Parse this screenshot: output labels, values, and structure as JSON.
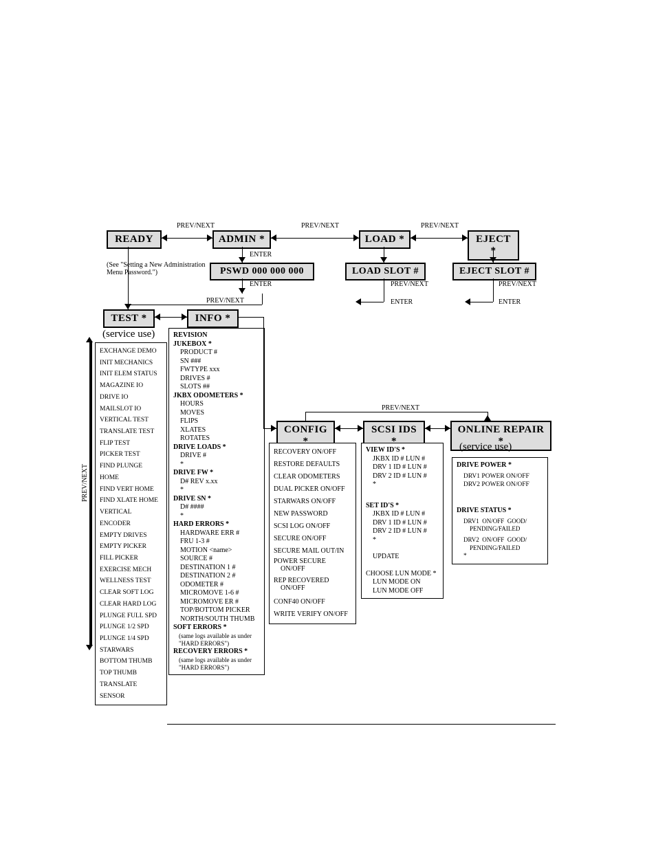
{
  "top": {
    "ready": "READY",
    "admin": "ADMIN *",
    "load": "LOAD *",
    "eject": "EJECT *",
    "pswd": "PSWD 000 000 000",
    "loadslot": "LOAD SLOT #",
    "ejectslot": "EJECT SLOT #",
    "setting_note": "(See \"Setting a New  Administration Menu Password.\")",
    "enter1": "ENTER",
    "enter2": "ENTER",
    "enter3": "ENTER",
    "enter4": "ENTER",
    "pn1": "PREV/NEXT",
    "pn2": "PREV/NEXT",
    "pn3": "PREV/NEXT",
    "pn4": "PREV/NEXT",
    "pn5": "PREV/NEXT",
    "pn6": "PREV/NEXT",
    "pn7": "PREV/NEXT",
    "pn8": "PREV/NEXT"
  },
  "mid": {
    "test": "TEST *",
    "info": "INFO *",
    "config": "CONFIG *",
    "scsi": "SCSI IDS *",
    "repair": "ONLINE REPAIR *",
    "svc1": "(service use)",
    "svc2": "(service use)",
    "vlabel": "PREV/NEXT"
  },
  "test_items": [
    "EXCHANGE DEMO",
    "INIT MECHANICS",
    "INIT ELEM  STATUS",
    "MAGAZINE IO",
    "DRIVE IO",
    "MAILSLOT IO",
    "VERTICAL TEST",
    "TRANSLATE TEST",
    "FLIP TEST",
    "PICKER TEST",
    "FIND PLUNGE HOME",
    "FIND VERT HOME",
    "FIND XLATE HOME",
    "VERTICAL ENCODER",
    "EMPTY DRIVES",
    "EMPTY  PICKER",
    "FILL PICKER",
    "EXERCISE MECH",
    "WELLNESS TEST",
    "CLEAR SOFT LOG",
    "CLEAR HARD LOG",
    "PLUNGE FULL SPD",
    "PLUNGE 1/2 SPD",
    "PLUNGE 1/4 SPD",
    "STARWARS",
    "BOTTOM THUMB",
    "TOP THUMB",
    "TRANSLATE SENSOR"
  ],
  "info": {
    "revision": "REVISION",
    "jukebox": "JUKEBOX *",
    "jb_items": [
      "PRODUCT #",
      "SN ###",
      "FWTYPE xxx",
      "DRIVES #",
      "SLOTS ##"
    ],
    "jkbx_odo": "JKBX ODOMETERS *",
    "odo_items": [
      "HOURS",
      "MOVES",
      "FLIPS",
      "XLATES",
      "ROTATES"
    ],
    "drive_loads": "DRIVE LOADS *",
    "dl_items": [
      "DRIVE #",
      "*"
    ],
    "drive_fw": "DRIVE FW *",
    "dfw_items": [
      "D# REV x.xx",
      "*"
    ],
    "drive_sn": "DRIVE SN *",
    "dsn_items": [
      "D# ####",
      "*"
    ],
    "hard": "HARD ERRORS *",
    "hard_items": [
      "HARDWARE ERR #",
      "FRU 1-3 #",
      "MOTION <name>",
      "SOURCE #",
      "DESTINATION 1 #",
      "DESTINATION 2 #",
      "ODOMETER #",
      "MICROMOVE 1-6 #",
      "MICROMOVE ER #",
      "TOP/BOTTOM PICKER",
      "NORTH/SOUTH THUMB"
    ],
    "soft": "SOFT ERRORS *",
    "soft_note": "(same logs available as under \"HARD ERRORS\")",
    "recov": "RECOVERY ERRORS *",
    "recov_note": "(same logs available as under \"HARD ERRORS\")"
  },
  "config_items": [
    "RECOVERY ON/OFF",
    "RESTORE DEFAULTS",
    "CLEAR ODOMETERS",
    "DUAL PICKER ON/OFF",
    "STARWARS ON/OFF",
    "NEW PASSWORD",
    "SCSI LOG ON/OFF",
    "SECURE ON/OFF",
    "SECURE  MAIL OUT/IN",
    "POWER SECURE ON/OFF",
    "REP RECOVERED ON/OFF",
    "CONF40 ON/OFF",
    "WRITE VERIFY ON/OFF"
  ],
  "scsi": {
    "view": "VIEW ID'S *",
    "view_items": [
      "JKBX ID # LUN #",
      "DRV 1 ID # LUN #",
      "DRV 2 ID # LUN #",
      "*"
    ],
    "set": "SET ID'S  *",
    "set_items": [
      "JKBX ID # LUN #",
      "DRV 1 ID # LUN #",
      "DRV 2 ID # LUN #",
      "*"
    ],
    "update": "UPDATE",
    "lun": "CHOOSE LUN MODE",
    "lun_items": [
      "LUN MODE ON",
      "LUN MODE OFF"
    ]
  },
  "repair": {
    "dpower": "DRIVE POWER *",
    "dp_items": [
      "DRV1 POWER ON/OFF",
      "DRV2 POWER ON/OFF"
    ],
    "dstatus": "DRIVE STATUS *",
    "ds_items": [
      "DRV1  ON/OFF  GOOD/ PENDING/FAILED",
      "DRV2  ON/OFF  GOOD/ PENDING/FAILED",
      "*"
    ]
  }
}
